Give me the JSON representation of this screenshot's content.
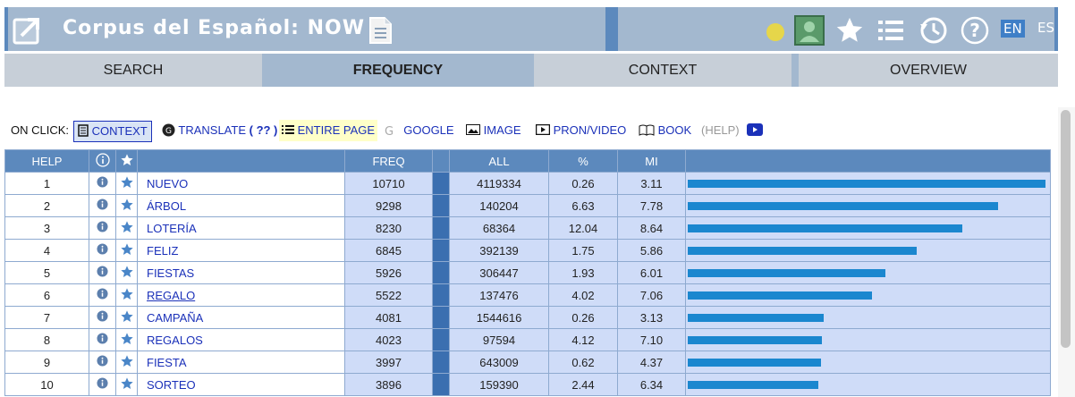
{
  "app": {
    "title": "Corpus del Español: NOW"
  },
  "lang": {
    "en": "EN",
    "es": "ES"
  },
  "tabs": [
    "SEARCH",
    "FREQUENCY",
    "CONTEXT",
    "OVERVIEW"
  ],
  "onclick": {
    "label": "ON CLICK:",
    "context": "CONTEXT",
    "translate": "TRANSLATE",
    "translate_q": "( ?? )",
    "entire": "ENTIRE PAGE",
    "google": "GOOGLE",
    "image": "IMAGE",
    "pron": "PRON/VIDEO",
    "book": "BOOK",
    "help": "(HELP)"
  },
  "table": {
    "headers": {
      "help": "HELP",
      "freq": "FREQ",
      "all": "ALL",
      "pct": "%",
      "mi": "MI"
    },
    "rows": [
      {
        "n": "1",
        "word": "NUEVO",
        "freq": "10710",
        "all": "4119334",
        "pct": "0.26",
        "mi": "3.11",
        "bar": 1.0
      },
      {
        "n": "2",
        "word": "ÁRBOL",
        "freq": "9298",
        "all": "140204",
        "pct": "6.63",
        "mi": "7.78",
        "bar": 0.868
      },
      {
        "n": "3",
        "word": "LOTERÍA",
        "freq": "8230",
        "all": "68364",
        "pct": "12.04",
        "mi": "8.64",
        "bar": 0.768
      },
      {
        "n": "4",
        "word": "FELIZ",
        "freq": "6845",
        "all": "392139",
        "pct": "1.75",
        "mi": "5.86",
        "bar": 0.639
      },
      {
        "n": "5",
        "word": "FIESTAS",
        "freq": "5926",
        "all": "306447",
        "pct": "1.93",
        "mi": "6.01",
        "bar": 0.553
      },
      {
        "n": "6",
        "word": "REGALO",
        "freq": "5522",
        "all": "137476",
        "pct": "4.02",
        "mi": "7.06",
        "bar": 0.516
      },
      {
        "n": "7",
        "word": "CAMPAÑA",
        "freq": "4081",
        "all": "1544616",
        "pct": "0.26",
        "mi": "3.13",
        "bar": 0.381
      },
      {
        "n": "8",
        "word": "REGALOS",
        "freq": "4023",
        "all": "97594",
        "pct": "4.12",
        "mi": "7.10",
        "bar": 0.376
      },
      {
        "n": "9",
        "word": "FIESTA",
        "freq": "3997",
        "all": "643009",
        "pct": "0.62",
        "mi": "4.37",
        "bar": 0.373
      },
      {
        "n": "10",
        "word": "SORTEO",
        "freq": "3896",
        "all": "159390",
        "pct": "2.44",
        "mi": "6.34",
        "bar": 0.364
      }
    ]
  }
}
